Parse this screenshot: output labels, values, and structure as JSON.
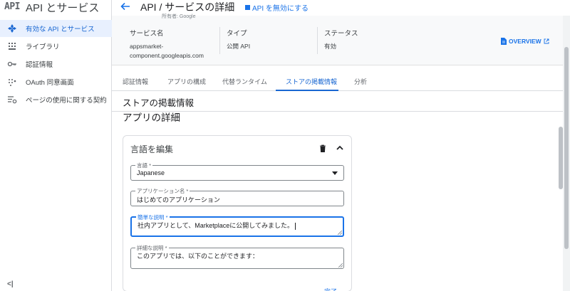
{
  "sidebar": {
    "logo": "API",
    "title": "API とサービス",
    "items": [
      {
        "label": "有効な API とサービス",
        "icon": "api-diamond-icon",
        "active": true
      },
      {
        "label": "ライブラリ",
        "icon": "library-grid-icon",
        "active": false
      },
      {
        "label": "認証情報",
        "icon": "key-icon",
        "active": false
      },
      {
        "label": "OAuth 同意画面",
        "icon": "oauth-dots-icon",
        "active": false
      },
      {
        "label": "ページの使用に関する契約",
        "icon": "settings-list-icon",
        "active": false
      }
    ],
    "collapse_label": "<|"
  },
  "header": {
    "title": "API / サービスの詳細",
    "disable_api_label": "API を無効にする",
    "owner_strip": "所有者: Google"
  },
  "info": {
    "service_name_key": "サービス名",
    "service_name_value_line1": "appsmarket-",
    "service_name_value_line2": "component.googleapis.com",
    "type_key": "タイプ",
    "type_value": "公開 API",
    "status_key": "ステータス",
    "status_value": "有効",
    "overview_label": "OVERVIEW"
  },
  "tabs": [
    {
      "label": "認証情報",
      "active": false
    },
    {
      "label": "アプリの構成",
      "active": false
    },
    {
      "label": "代替ランタイム",
      "active": false
    },
    {
      "label": "ストアの掲載情報",
      "active": true
    },
    {
      "label": "分析",
      "active": false
    }
  ],
  "section_title": "ストアの掲載情報",
  "app_details_title": "アプリの詳細",
  "card": {
    "title": "言語を編集",
    "language": {
      "label": "言語 *",
      "value": "Japanese"
    },
    "app_name": {
      "label": "アプリケーション名 *",
      "value": "はじめてのアプリケーション"
    },
    "short_desc": {
      "label": "簡単な説明 *",
      "value": "社内アプリとして、Marketplaceに公開してみました。"
    },
    "long_desc": {
      "label": "詳細な説明 *",
      "value": "このアプリでは、以下のことができます："
    },
    "done_label": "完了"
  },
  "colors": {
    "accent": "#1a73e8",
    "active_bg": "#e8f0fe",
    "panel_bg": "#f8f9fa"
  }
}
